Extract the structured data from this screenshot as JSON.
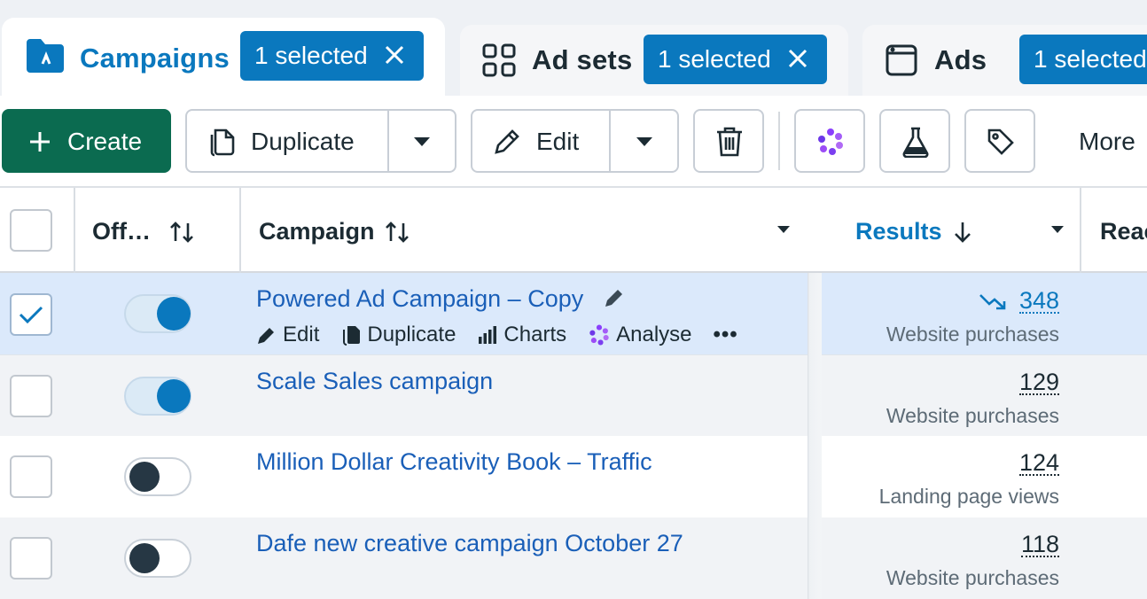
{
  "tabs": [
    {
      "label": "Campaigns",
      "badge": "1 selected",
      "icon": "folder-icon",
      "active": true
    },
    {
      "label": "Ad sets",
      "badge": "1 selected",
      "icon": "grid-icon",
      "active": false
    },
    {
      "label": "Ads",
      "badge": "1 selected",
      "icon": "window-icon",
      "active": false
    }
  ],
  "toolbar": {
    "create_label": "Create",
    "duplicate_label": "Duplicate",
    "edit_label": "Edit",
    "more_label": "More"
  },
  "table": {
    "headers": {
      "off": "Off…",
      "campaign": "Campaign",
      "results": "Results",
      "reach": "Reac"
    },
    "row_actions": {
      "edit": "Edit",
      "duplicate": "Duplicate",
      "charts": "Charts",
      "analyse": "Analyse",
      "more": "•••"
    },
    "rows": [
      {
        "name": "Powered Ad Campaign – Copy",
        "selected": true,
        "toggle_on": true,
        "result": "348",
        "result_label": "Website purchases"
      },
      {
        "name": "Scale Sales campaign",
        "selected": false,
        "toggle_on": true,
        "result": "129",
        "result_label": "Website purchases"
      },
      {
        "name": "Million Dollar Creativity Book – Traffic",
        "selected": false,
        "toggle_on": false,
        "result": "124",
        "result_label": "Landing page views"
      },
      {
        "name": "Dafe new creative campaign October 27",
        "selected": false,
        "toggle_on": false,
        "result": "118",
        "result_label": "Website purchases"
      }
    ]
  },
  "colors": {
    "accent": "#0a78be",
    "create": "#0b6b50",
    "link": "#1a5fb8",
    "selected_row": "#dbe9fb"
  }
}
